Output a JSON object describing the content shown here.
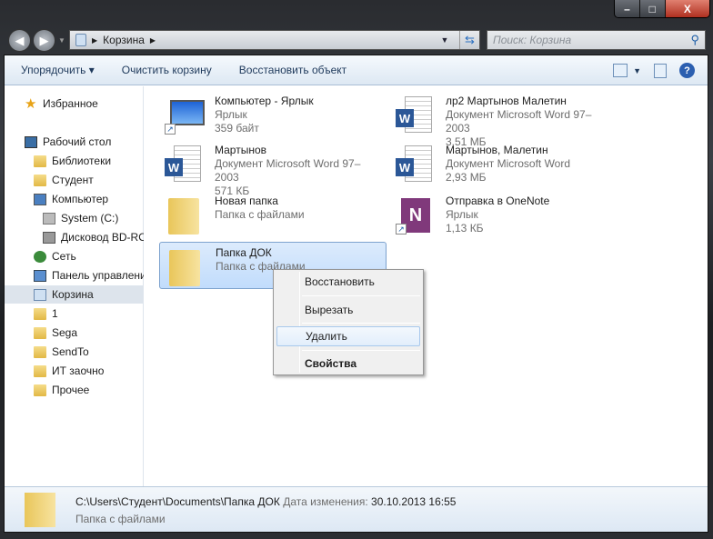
{
  "window": {
    "minimize": "–",
    "maximize": "□",
    "close": "X"
  },
  "address": {
    "path": "Корзина",
    "search_placeholder": "Поиск: Корзина"
  },
  "toolbar": {
    "organize": "Упорядочить ▾",
    "empty": "Очистить корзину",
    "restore": "Восстановить объект",
    "help": "?"
  },
  "sidebar": {
    "items": [
      {
        "label": "Избранное",
        "icon": "star"
      },
      {
        "label": "Рабочий стол",
        "icon": "desktop"
      },
      {
        "label": "Библиотеки",
        "icon": "libraries"
      },
      {
        "label": "Студент",
        "icon": "user-folder"
      },
      {
        "label": "Компьютер",
        "icon": "computer"
      },
      {
        "label": "System (C:)",
        "icon": "drive"
      },
      {
        "label": "Дисковод BD-ROM",
        "icon": "disc-drive"
      },
      {
        "label": "Сеть",
        "icon": "network"
      },
      {
        "label": "Панель управления",
        "icon": "control-panel"
      },
      {
        "label": "Корзина",
        "icon": "recycle-bin"
      },
      {
        "label": "1",
        "icon": "folder"
      },
      {
        "label": "Sega",
        "icon": "folder"
      },
      {
        "label": "SendTo",
        "icon": "folder"
      },
      {
        "label": "ИТ заочно",
        "icon": "folder"
      },
      {
        "label": "Прочее",
        "icon": "folder"
      }
    ]
  },
  "files": [
    {
      "name": "Компьютер - Ярлык",
      "type": "Ярлык",
      "size": "359 байт",
      "icon": "computer-shortcut"
    },
    {
      "name": "лр2 Мартынов Малетин",
      "type": "Документ Microsoft Word 97–2003",
      "size": "3,51 МБ",
      "icon": "word-doc"
    },
    {
      "name": "Мартынов",
      "type": "Документ Microsoft Word 97–2003",
      "size": "571 КБ",
      "icon": "word-doc"
    },
    {
      "name": "Мартынов, Малетин",
      "type": "Документ Microsoft Word",
      "size": "2,93 МБ",
      "icon": "word-doc"
    },
    {
      "name": "Новая папка",
      "type": "Папка с файлами",
      "icon": "folder"
    },
    {
      "name": "Отправка в OneNote",
      "type": "Ярлык",
      "size": "1,13 КБ",
      "icon": "onenote-shortcut"
    },
    {
      "name": "Папка ДОК",
      "type": "Папка с файлами",
      "icon": "folder"
    }
  ],
  "context_menu": {
    "restore": "Восстановить",
    "cut": "Вырезать",
    "delete": "Удалить",
    "properties": "Свойства"
  },
  "status": {
    "path": "C:\\Users\\Студент\\Documents\\Папка ДОК",
    "date_label": "Дата изменения:",
    "date": "30.10.2013 16:55",
    "type": "Папка с файлами"
  }
}
